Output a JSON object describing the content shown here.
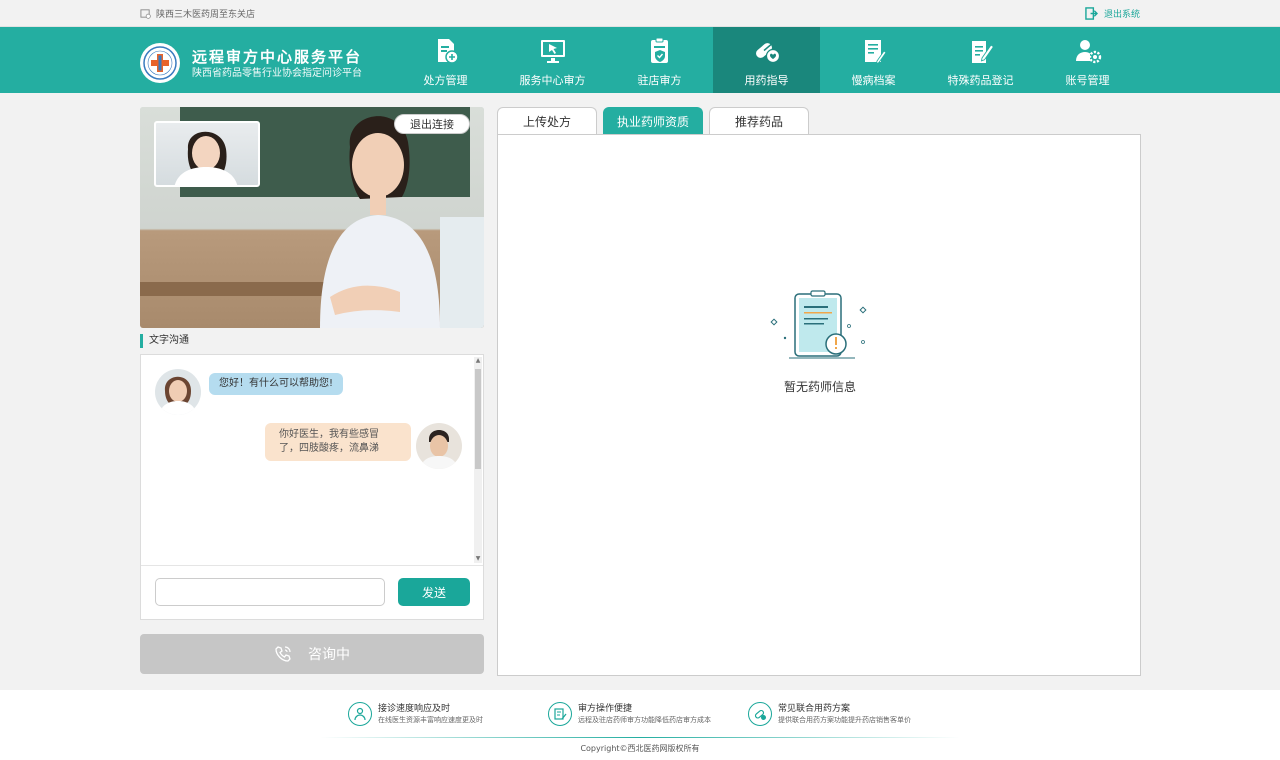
{
  "topbar": {
    "store_name": "陕西三木医药周至东关店",
    "logout_label": "退出系统"
  },
  "header": {
    "title": "远程审方中心服务平台",
    "subtitle": "陕西省药品零售行业协会指定问诊平台",
    "nav": [
      {
        "label": "处方管理",
        "icon": "prescription-add-icon"
      },
      {
        "label": "服务中心审方",
        "icon": "monitor-cursor-icon"
      },
      {
        "label": "驻店审方",
        "icon": "clipboard-shield-icon"
      },
      {
        "label": "用药指导",
        "icon": "pill-capsule-icon"
      },
      {
        "label": "慢病档案",
        "icon": "document-pen-icon"
      },
      {
        "label": "特殊药品登记",
        "icon": "document-edit-icon"
      },
      {
        "label": "账号管理",
        "icon": "user-gear-icon"
      }
    ],
    "active_nav": "用药指导"
  },
  "video": {
    "exit_label": "退出连接"
  },
  "chat": {
    "section_title": "文字沟通",
    "doctor_message": "您好！有什么可以帮助您!",
    "patient_message": "你好医生，我有些感冒了，四肢酸疼，流鼻涕",
    "input_placeholder": "",
    "send_label": "发送"
  },
  "consult": {
    "label": "咨询中"
  },
  "tabs": [
    {
      "label": "上传处方"
    },
    {
      "label": "执业药师资质"
    },
    {
      "label": "推荐药品"
    }
  ],
  "active_tab": "执业药师资质",
  "empty_state": {
    "text": "暂无药师信息"
  },
  "footer": {
    "features": [
      {
        "title": "接诊速度响应及时",
        "desc": "在线医生资源丰富响应速度更及时"
      },
      {
        "title": "审方操作便捷",
        "desc": "远程及驻店药师审方功能降低药店审方成本"
      },
      {
        "title": "常见联合用药方案",
        "desc": "提供联合用药方案功能提升药店销售客单价"
      }
    ],
    "copyright": "Copyright©西北医药网版权所有"
  },
  "colors": {
    "primary": "#24aea1",
    "primary_dark": "#1a877c",
    "doctor_bubble": "#b5dcef",
    "patient_bubble": "#fae3cd",
    "consult_disabled": "#c6c6c6"
  }
}
